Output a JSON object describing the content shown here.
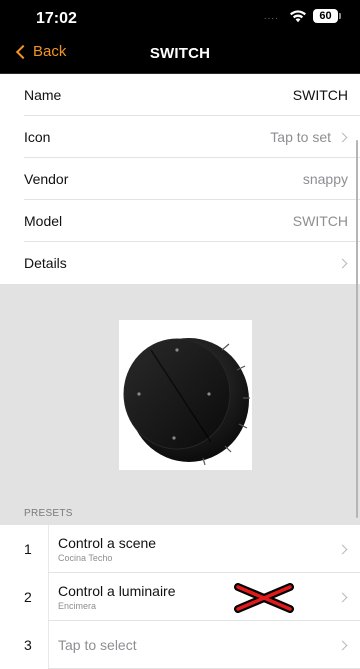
{
  "status_bar": {
    "time": "17:02",
    "signal_dots": "....",
    "battery": "60",
    "wifi_icon": "wifi-icon"
  },
  "nav": {
    "back_label": "Back",
    "title": "SWITCH",
    "accent_color": "#f3941e"
  },
  "rows": [
    {
      "label": "Name",
      "value": "SWITCH"
    },
    {
      "label": "Icon",
      "value": "Tap to set"
    },
    {
      "label": "Vendor",
      "value": "snappy"
    },
    {
      "label": "Model",
      "value": "SWITCH"
    },
    {
      "label": "Details",
      "value": ""
    }
  ],
  "device_image": {
    "icon": "rotary-switch-image"
  },
  "presets": {
    "header": "PRESETS",
    "items": [
      {
        "number": "1",
        "title": "Control a scene",
        "subtitle": "Cocina Techo"
      },
      {
        "number": "2",
        "title": "Control a luminaire",
        "subtitle": "Encimera"
      },
      {
        "number": "3",
        "placeholder": "Tap to select"
      }
    ]
  },
  "colors": {
    "background": "#ffffff",
    "nav_background": "#000000",
    "gray_area": "#e2e2e2",
    "delete_red": "#e21a1a"
  }
}
